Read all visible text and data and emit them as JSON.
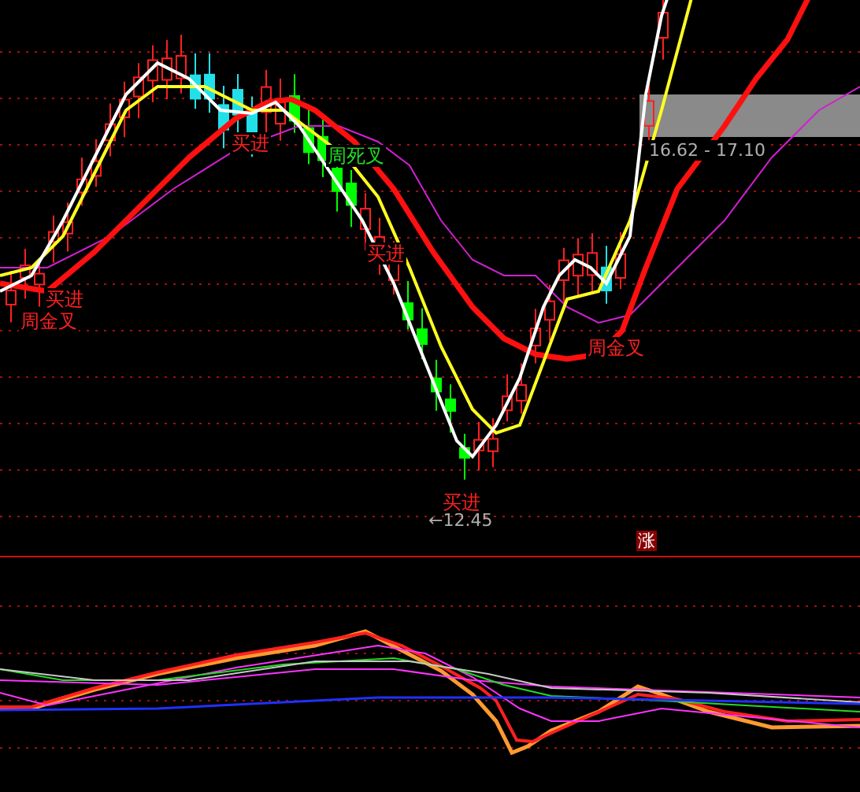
{
  "main_chart": {
    "signals": [
      {
        "kind": "golden_cross",
        "text": "周金叉"
      },
      {
        "kind": "buy",
        "text": "买进"
      },
      {
        "kind": "buy",
        "text": "买进"
      },
      {
        "kind": "death_cross",
        "text": "周死叉"
      },
      {
        "kind": "buy",
        "text": "买进"
      },
      {
        "kind": "buy",
        "text": "买进"
      },
      {
        "kind": "golden_cross",
        "text": "周金叉"
      }
    ],
    "price_range": "16.62 - 17.10",
    "low_marker": "←12.45"
  },
  "divider_badge": "涨"
}
